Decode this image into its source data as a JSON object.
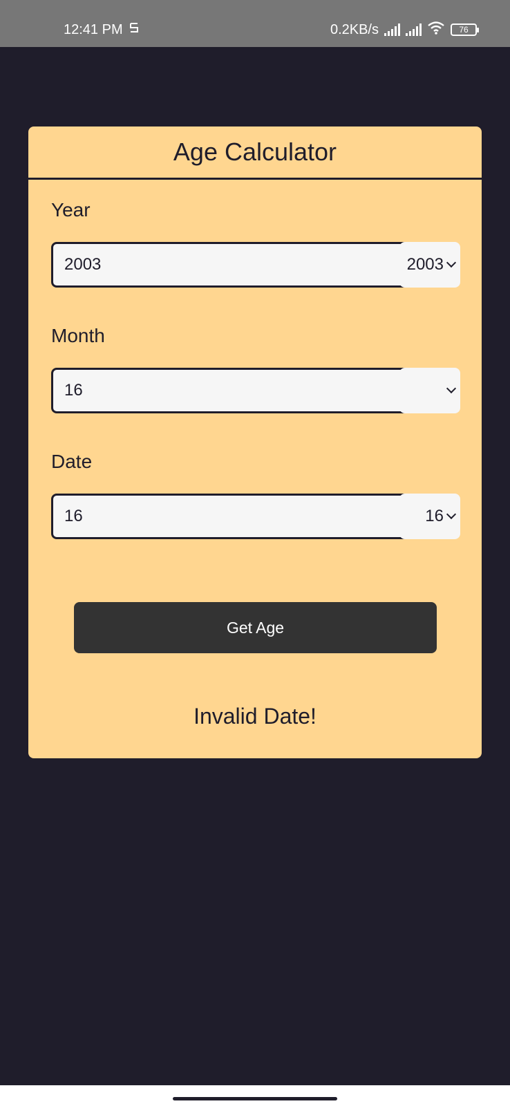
{
  "status_bar": {
    "time": "12:41 PM",
    "notification_icon": "s-logo-icon",
    "network_speed": "0.2KB/s",
    "battery_level": "76"
  },
  "card": {
    "title": "Age Calculator",
    "year": {
      "label": "Year",
      "input_value": "2003",
      "selected_value": "2003"
    },
    "month": {
      "label": "Month",
      "input_value": "16",
      "selected_value": ""
    },
    "date": {
      "label": "Date",
      "input_value": "16",
      "selected_value": "16"
    },
    "button_label": "Get Age",
    "result": "Invalid Date!"
  },
  "colors": {
    "background": "#1f1d2b",
    "card": "#ffd690",
    "button": "#333333",
    "input": "#f6f6f6",
    "status_bar": "#777777"
  }
}
